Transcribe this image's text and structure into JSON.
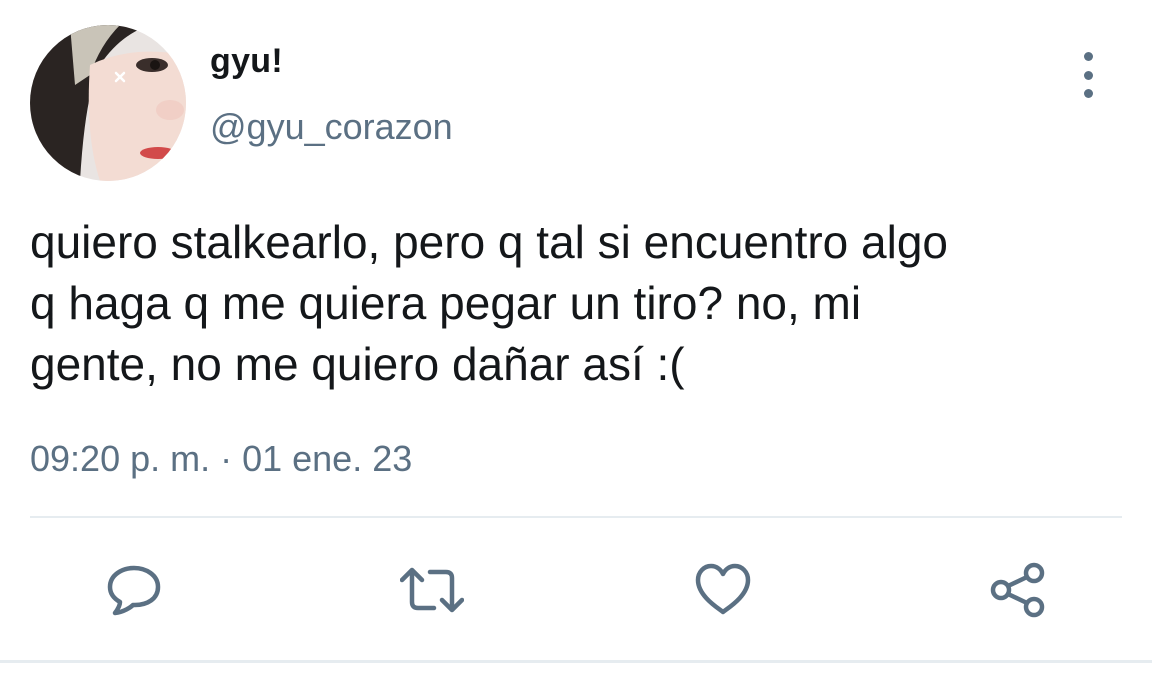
{
  "tweet": {
    "display_name": "gyu!",
    "handle": "@gyu_corazon",
    "text": "quiero stalkearlo, pero q tal si encuentro algo\nq haga q me quiera pegar un tiro? no, mi\ngente, no me quiero dañar así :(",
    "timestamp": "09:20 p. m. · 01 ene. 23"
  },
  "icons": {
    "more": "more-vertical-icon",
    "reply": "reply-icon",
    "retweet": "retweet-icon",
    "like": "heart-icon",
    "share": "share-icon"
  },
  "colors": {
    "text": "#14171a",
    "secondary": "#5b7083",
    "divider": "#e6ecf0"
  }
}
